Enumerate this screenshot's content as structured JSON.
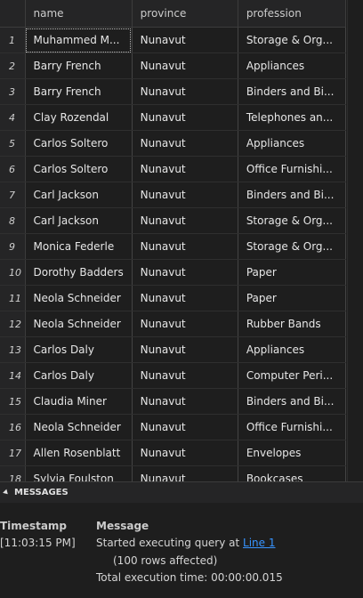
{
  "grid": {
    "columns": [
      "name",
      "province",
      "profession"
    ],
    "rows": [
      {
        "n": "1",
        "name": "Muhammed M...",
        "province": "Nunavut",
        "profession": "Storage & Org..."
      },
      {
        "n": "2",
        "name": "Barry French",
        "province": "Nunavut",
        "profession": "Appliances"
      },
      {
        "n": "3",
        "name": "Barry French",
        "province": "Nunavut",
        "profession": "Binders and Bi..."
      },
      {
        "n": "4",
        "name": "Clay Rozendal",
        "province": "Nunavut",
        "profession": "Telephones an..."
      },
      {
        "n": "5",
        "name": "Carlos Soltero",
        "province": "Nunavut",
        "profession": "Appliances"
      },
      {
        "n": "6",
        "name": "Carlos Soltero",
        "province": "Nunavut",
        "profession": "Office Furnishi..."
      },
      {
        "n": "7",
        "name": "Carl Jackson",
        "province": "Nunavut",
        "profession": "Binders and Bi..."
      },
      {
        "n": "8",
        "name": "Carl Jackson",
        "province": "Nunavut",
        "profession": "Storage & Org..."
      },
      {
        "n": "9",
        "name": "Monica Federle",
        "province": "Nunavut",
        "profession": "Storage & Org..."
      },
      {
        "n": "10",
        "name": "Dorothy Badders",
        "province": "Nunavut",
        "profession": "Paper"
      },
      {
        "n": "11",
        "name": "Neola Schneider",
        "province": "Nunavut",
        "profession": "Paper"
      },
      {
        "n": "12",
        "name": "Neola Schneider",
        "province": "Nunavut",
        "profession": "Rubber Bands"
      },
      {
        "n": "13",
        "name": "Carlos Daly",
        "province": "Nunavut",
        "profession": "Appliances"
      },
      {
        "n": "14",
        "name": "Carlos Daly",
        "province": "Nunavut",
        "profession": "Computer Peri..."
      },
      {
        "n": "15",
        "name": "Claudia Miner",
        "province": "Nunavut",
        "profession": "Binders and Bi..."
      },
      {
        "n": "16",
        "name": "Neola Schneider",
        "province": "Nunavut",
        "profession": "Office Furnishi..."
      },
      {
        "n": "17",
        "name": "Allen Rosenblatt",
        "province": "Nunavut",
        "profession": "Envelopes"
      },
      {
        "n": "18",
        "name": "Sylvia Foulston",
        "province": "Nunavut",
        "profession": "Bookcases"
      }
    ]
  },
  "messages": {
    "header": "MESSAGES",
    "col_timestamp": "Timestamp",
    "col_message": "Message",
    "timestamp": "[11:03:15 PM]",
    "line1_prefix": "Started executing query at ",
    "line1_link": "Line 1",
    "line2": "(100 rows affected)",
    "line3": "Total execution time: 00:00:00.015"
  }
}
